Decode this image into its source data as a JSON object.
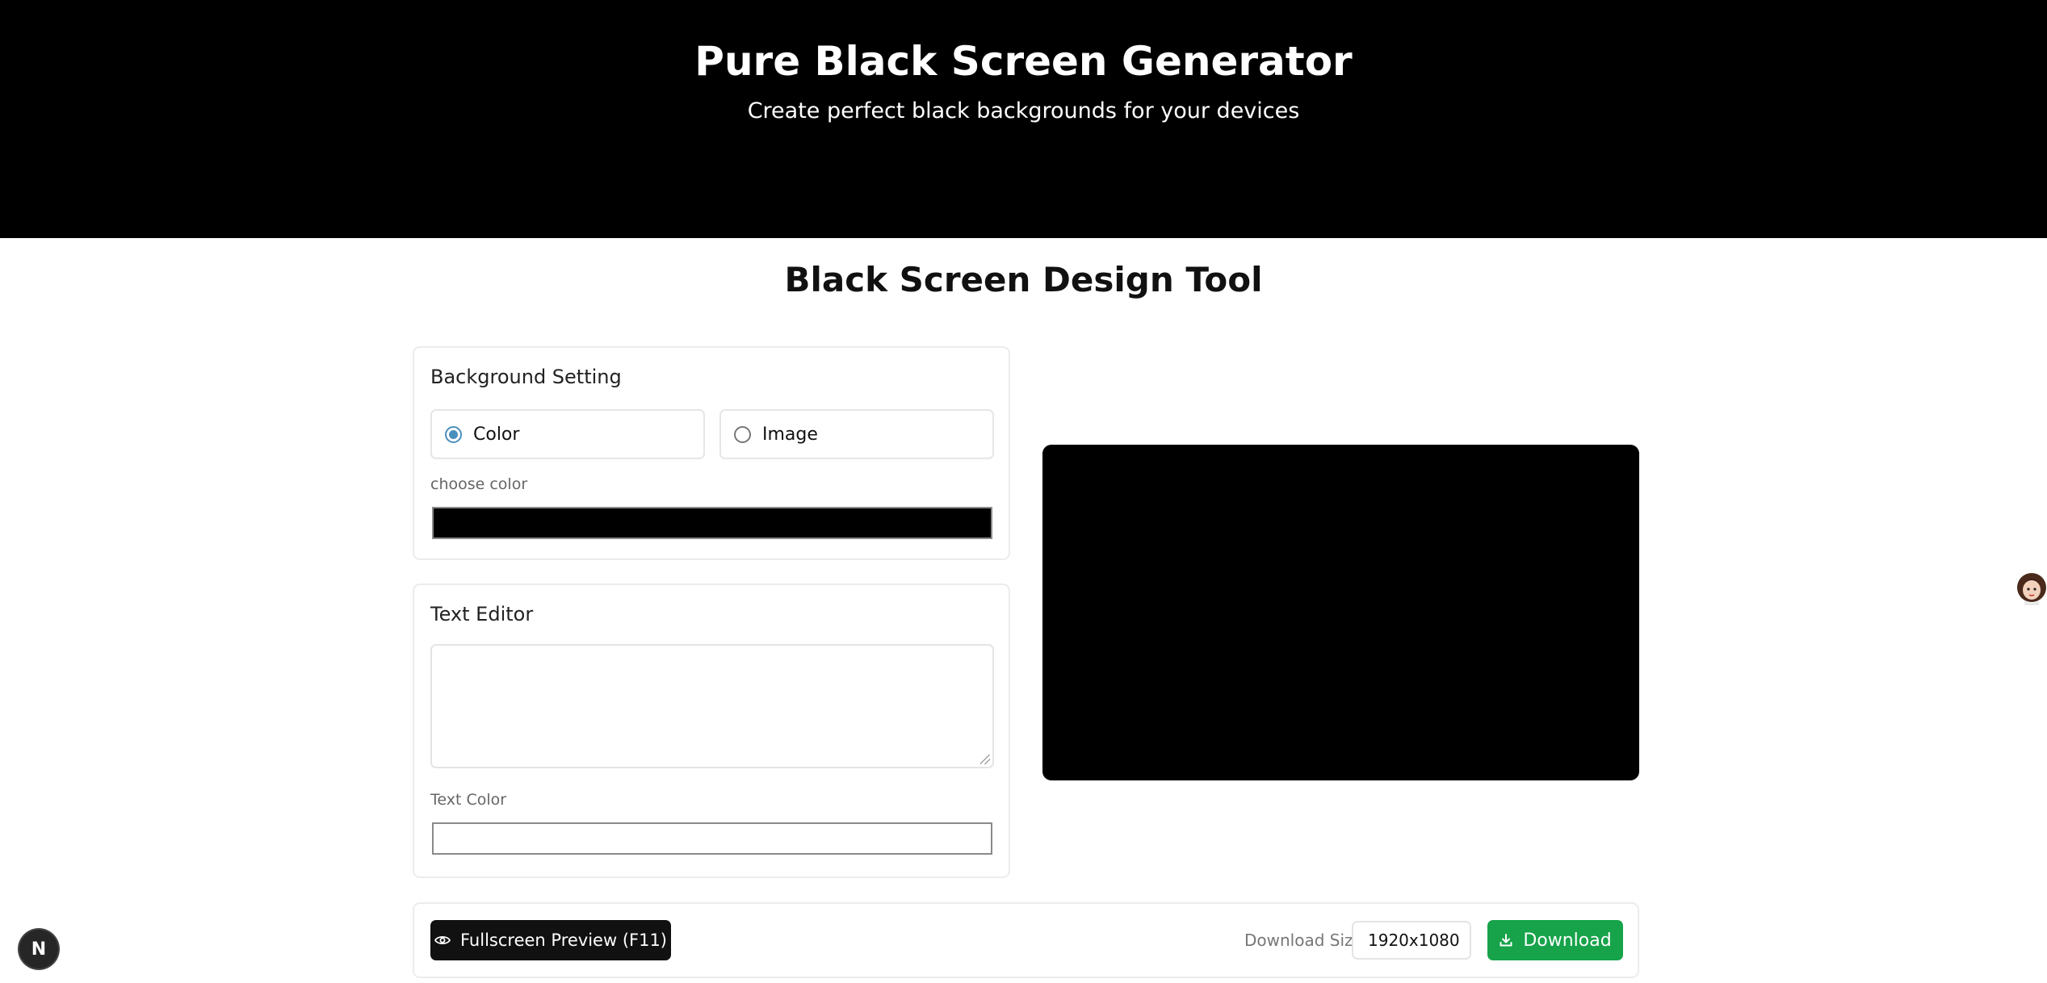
{
  "hero": {
    "title": "Pure Black Screen Generator",
    "subtitle": "Create perfect black backgrounds for your devices"
  },
  "tool": {
    "title": "Black Screen Design Tool"
  },
  "background_setting": {
    "heading": "Background Setting",
    "options": [
      {
        "label": "Color",
        "checked": true
      },
      {
        "label": "Image",
        "checked": false
      }
    ],
    "color_label": "choose color",
    "color_value": "#000000"
  },
  "text_editor": {
    "heading": "Text Editor",
    "text_value": "",
    "text_color_label": "Text Color",
    "text_color_value": "#ffffff"
  },
  "preview": {
    "background": "#000000"
  },
  "bottom_bar": {
    "fullscreen_label": "Fullscreen Preview (F11)",
    "download_size_label": "Download Size",
    "download_size_value": "1920x1080",
    "download_label": "Download"
  },
  "colors": {
    "hero_bg": "#000000",
    "download_button": "#16a34a",
    "radio_accent": "#4a8fbd"
  },
  "floating": {
    "next_badge": "N"
  }
}
